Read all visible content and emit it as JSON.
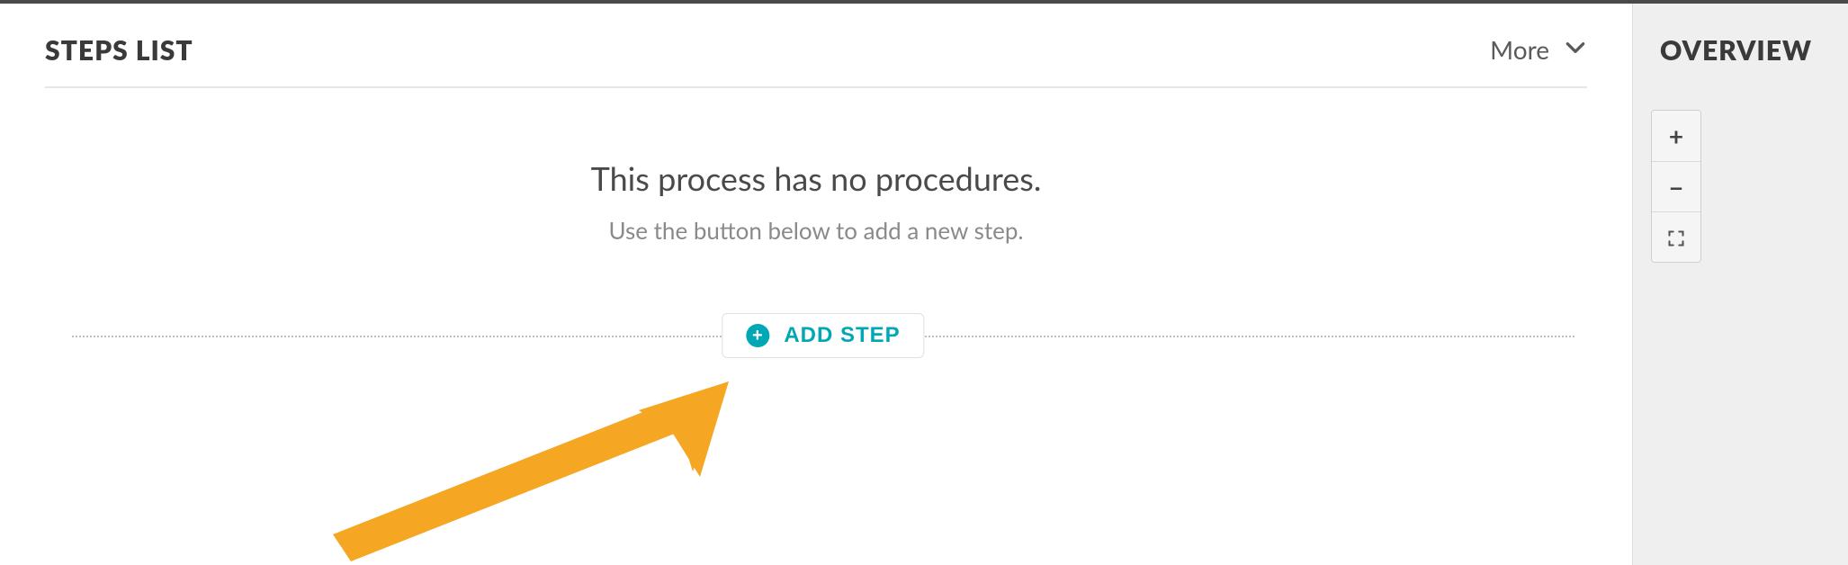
{
  "main": {
    "title": "STEPS LIST",
    "more_label": "More",
    "empty_headline": "This process has no procedures.",
    "empty_sub": "Use the button below to add a new step.",
    "add_step_label": "ADD STEP"
  },
  "overview": {
    "title": "OVERVIEW",
    "zoom_in_label": "+",
    "zoom_out_label": "−"
  },
  "annotation": {
    "type": "arrow",
    "color": "#f5a623"
  }
}
